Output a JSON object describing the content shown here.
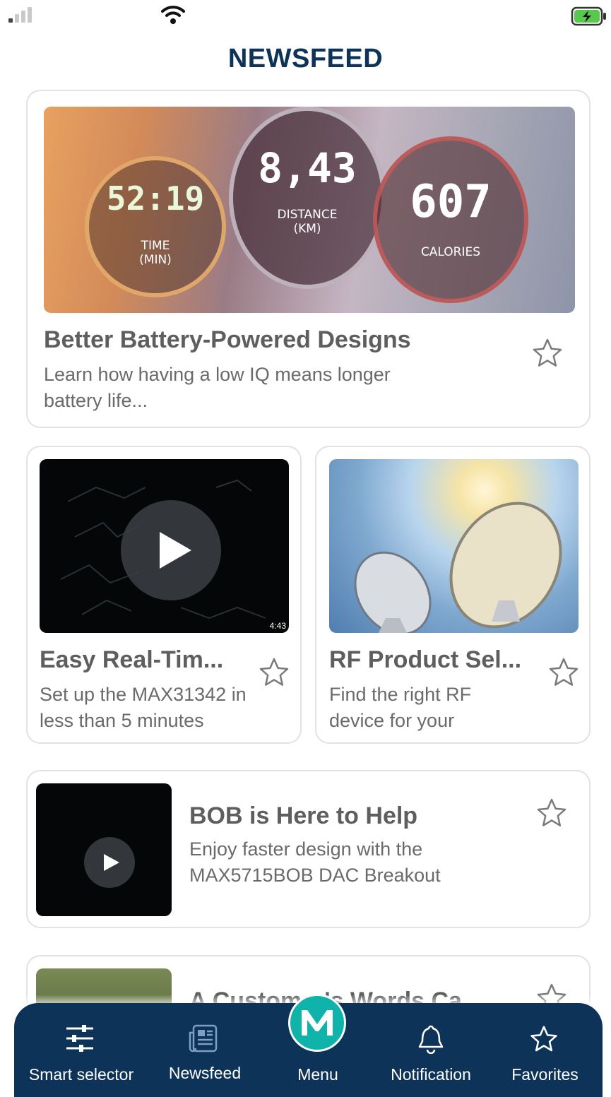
{
  "status_bar": {
    "signal_icon": "signal-icon",
    "wifi_icon": "wifi-icon",
    "battery_icon": "battery-charging-icon"
  },
  "header": {
    "title": "NEWSFEED"
  },
  "feed": {
    "featured": {
      "title": "Better Battery-Powered Designs",
      "description": "Learn how having a low IQ means longer battery life...",
      "image": {
        "time_value": "52:19",
        "time_label": "TIME (MIN)",
        "distance_value": "8,43",
        "distance_label": "DISTANCE (KM)",
        "calories_value": "607",
        "calories_label": "CALORIES"
      }
    },
    "grid": [
      {
        "title": "Easy Real-Tim...",
        "description": "Set up the MAX31342 in less than 5 minutes",
        "duration": "4:43"
      },
      {
        "title": "RF Product Sel...",
        "description": "Find the right RF device for your"
      }
    ],
    "list": [
      {
        "title": "BOB is Here to Help",
        "description": "Enjoy faster design with the MAX5715BOB DAC Breakout"
      },
      {
        "title": "A Customer's Words Ca..."
      }
    ]
  },
  "tabbar": {
    "items": [
      {
        "label": "Smart selector",
        "icon": "sliders-icon"
      },
      {
        "label": "Newsfeed",
        "icon": "newspaper-icon"
      },
      {
        "label": "Menu",
        "icon": "maxim-logo-icon"
      },
      {
        "label": "Notification",
        "icon": "bell-icon"
      },
      {
        "label": "Favorites",
        "icon": "star-icon"
      }
    ]
  },
  "colors": {
    "brand_navy": "#0d3359",
    "brand_teal": "#0fb3a9",
    "card_border": "#e2e2e2"
  }
}
